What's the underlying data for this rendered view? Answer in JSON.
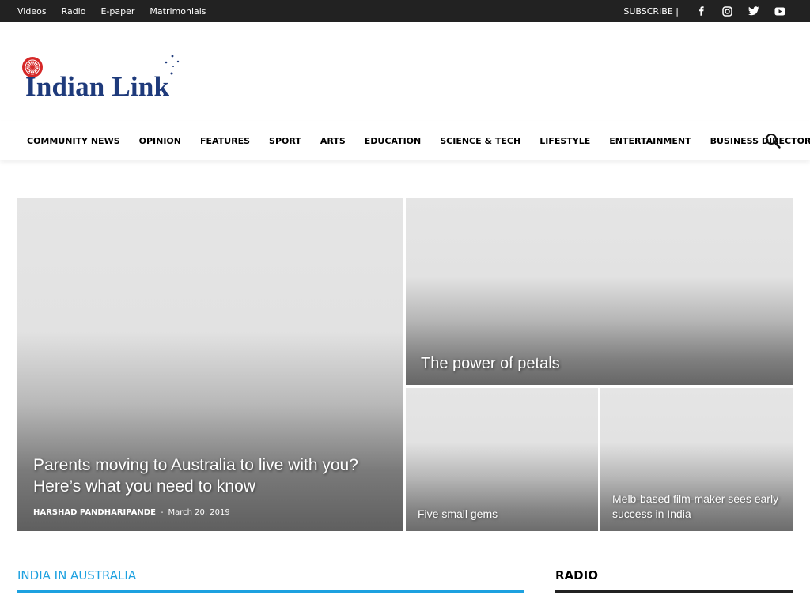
{
  "topbar": {
    "links": [
      "Videos",
      "Radio",
      "E-paper",
      "Matrimonials"
    ],
    "subscribe": "SUBSCRIBE |",
    "social": [
      "facebook-icon",
      "instagram-icon",
      "twitter-icon",
      "youtube-icon"
    ]
  },
  "logo": {
    "text": "Indian Link"
  },
  "nav": {
    "items": [
      "COMMUNITY NEWS",
      "OPINION",
      "FEATURES",
      "SPORT",
      "ARTS",
      "EDUCATION",
      "SCIENCE & TECH",
      "LIFESTYLE",
      "ENTERTAINMENT",
      "BUSINESS DIRECTORY"
    ]
  },
  "featured": {
    "main": {
      "title": "Parents moving to Australia to live with you? Here’s what you need to know",
      "author": "HARSHAD PANDHARIPANDE",
      "separator": "-",
      "date": "March 20, 2019"
    },
    "top": {
      "title": "The power of petals"
    },
    "small1": {
      "title": "Five small gems"
    },
    "small2": {
      "title": "Melb-based film-maker sees early success in India"
    }
  },
  "sections": {
    "india": {
      "title": "INDIA IN AUSTRALIA",
      "color": "#1da1e0"
    },
    "radio": {
      "title": "RADIO"
    }
  },
  "colors": {
    "topbar": "#222222",
    "accent": "#1da1e0",
    "logo_blue": "#1e3a7b",
    "logo_red": "#d62828"
  }
}
